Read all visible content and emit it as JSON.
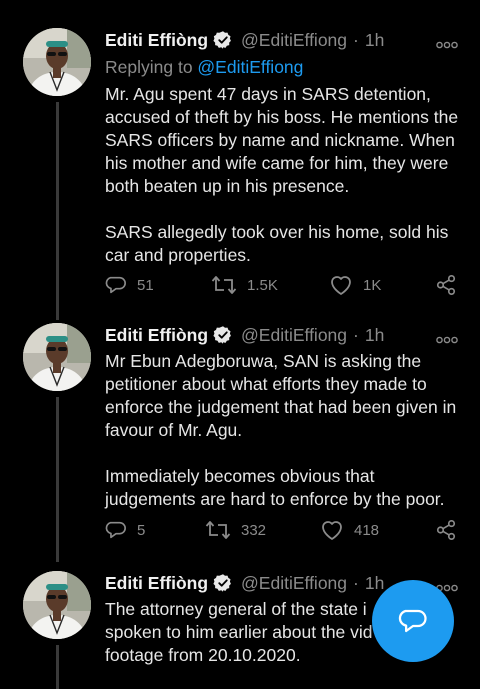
{
  "tweets": [
    {
      "author_name": "Editi Effiòng",
      "handle": "@EditiEffiong",
      "separator": "·",
      "time": "1h",
      "replying_label": "Replying to ",
      "replying_handle": "@EditiEffiong",
      "paragraphs": [
        "Mr. Agu spent 47 days in SARS detention, accused of theft by his boss. He mentions the SARS officers by name and nickname. When his mother and wife came for him, they were both beaten up in his presence.",
        "SARS allegedly took over his home, sold his car and properties."
      ],
      "replies": "51",
      "retweets": "1.5K",
      "likes": "1K"
    },
    {
      "author_name": "Editi Effiòng",
      "handle": "@EditiEffiong",
      "separator": "·",
      "time": "1h",
      "paragraphs": [
        "Mr Ebun Adegboruwa, SAN is asking the petitioner about what efforts they made to enforce the judgement that had been given in favour of Mr. Agu.",
        "Immediately becomes obvious that judgements are hard to enforce by the poor."
      ],
      "replies": "5",
      "retweets": "332",
      "likes": "418"
    },
    {
      "author_name": "Editi Effiòng",
      "handle": "@EditiEffiong",
      "separator": "·",
      "time": "1h",
      "lines": [
        "The attorney general of the state i",
        "spoken to him earlier about the vid",
        "footage from 20.10.2020."
      ]
    }
  ],
  "icons": {
    "verified": "verified-badge-icon",
    "more": "more-options-icon",
    "reply": "reply-icon",
    "retweet": "retweet-icon",
    "like": "heart-icon",
    "share": "share-icon",
    "compose": "new-tweet-icon"
  },
  "colors": {
    "background": "#000000",
    "accent": "#1d9bf0",
    "muted": "#8b8b8b",
    "text": "#e6e6e6"
  }
}
